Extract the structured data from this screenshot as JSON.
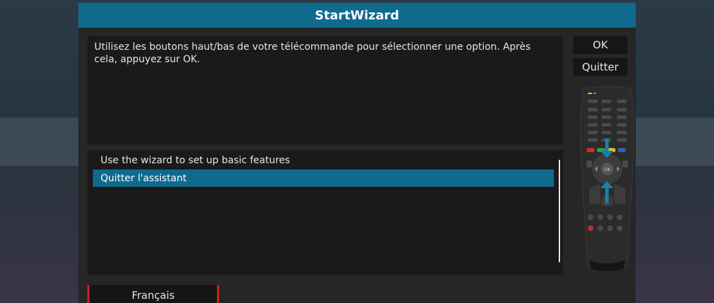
{
  "window": {
    "title": "StartWizard"
  },
  "description": {
    "text": "Utilisez les boutons haut/bas de votre télécommande pour sélectionner une option. Après cela, appuyez sur OK."
  },
  "list": {
    "items": [
      {
        "label": "Use the wizard to set up basic features",
        "selected": false
      },
      {
        "label": "Quitter l'assistant",
        "selected": true
      }
    ]
  },
  "buttons": {
    "ok_label": "OK",
    "quit_label": "Quitter",
    "language_label": "Français"
  },
  "remote": {
    "ok_key_label": "OK"
  },
  "colors": {
    "accent": "#0f6a8e",
    "language_border": "#d42020",
    "arrow": "#1a7fa8"
  },
  "icons": {
    "remote": "remote-control-icon",
    "up_arrow": "arrow-up-icon",
    "down_arrow": "arrow-down-icon"
  }
}
